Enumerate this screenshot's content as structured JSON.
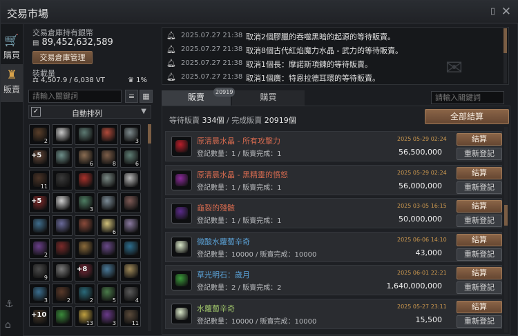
{
  "window": {
    "title": "交易市場",
    "phone_icon": "phone-icon",
    "close_icon": "close-icon"
  },
  "nav": {
    "items": [
      {
        "label": "購買",
        "icon": "cart-icon"
      },
      {
        "label": "販賣",
        "icon": "money-bag-icon"
      }
    ],
    "bottom_icons": [
      "anchor-icon",
      "camp-icon"
    ]
  },
  "warehouse": {
    "label": "交易倉庫持有銀幣",
    "amount": "89,452,632,589",
    "manage_label": "交易倉庫管理",
    "load_label": "裝載量",
    "load_value": "4,507.9 / 6,038 VT",
    "load_pct": "1%"
  },
  "inventory": {
    "search_placeholder": "請輸入關鍵詞",
    "sort_label": "自動排列",
    "sort_checked": "✓",
    "slots": [
      {
        "color": "#5a3f2a",
        "count": "2"
      },
      {
        "color": "#c8c8c8",
        "count": ""
      },
      {
        "color": "#5d7a73",
        "count": ""
      },
      {
        "color": "#b04a3a",
        "count": ""
      },
      {
        "color": "#7e8a8d",
        "count": "3"
      },
      {
        "color": "#6b4b3b",
        "count": "",
        "plus": "+5"
      },
      {
        "color": "#6e8f8a",
        "count": ""
      },
      {
        "color": "#8b6d52",
        "count": "6"
      },
      {
        "color": "#7d5e49",
        "count": "8"
      },
      {
        "color": "#5f7d74",
        "count": "6"
      },
      {
        "color": "#4a3326",
        "count": "11"
      },
      {
        "color": "#3a3a3a",
        "count": ""
      },
      {
        "color": "#a8312b",
        "count": ""
      },
      {
        "color": "#7b8a86",
        "count": ""
      },
      {
        "color": "#b9b9b9",
        "count": ""
      },
      {
        "color": "#8c2d2d",
        "count": "",
        "plus": "+5"
      },
      {
        "color": "#cfcfcf",
        "count": ""
      },
      {
        "color": "#4e7d63",
        "count": "3"
      },
      {
        "color": "#7b8b96",
        "count": ""
      },
      {
        "color": "#7d5a56",
        "count": ""
      },
      {
        "color": "#3f6d8c",
        "count": ""
      },
      {
        "color": "#6a6a9a",
        "count": ""
      },
      {
        "color": "#8a4a3a",
        "count": ""
      },
      {
        "color": "#d0c07a",
        "count": "6"
      },
      {
        "color": "#8a7aa0",
        "count": ""
      },
      {
        "color": "#6a3f8a",
        "count": "2"
      },
      {
        "color": "#7a2a2a",
        "count": ""
      },
      {
        "color": "#8a6a3a",
        "count": ""
      },
      {
        "color": "#6a4a8a",
        "count": ""
      },
      {
        "color": "#2d6d8d",
        "count": ""
      },
      {
        "color": "#4a4a4a",
        "count": "9"
      },
      {
        "color": "#7a7a7a",
        "count": ""
      },
      {
        "color": "#7a2a3a",
        "count": "",
        "plus": "+8"
      },
      {
        "color": "#4a7a9a",
        "count": ""
      },
      {
        "color": "#a08a5a",
        "count": ""
      },
      {
        "color": "#3a6d8d",
        "count": "3"
      },
      {
        "color": "#5a3a2a",
        "count": "2"
      },
      {
        "color": "#2a6a7a",
        "count": "2"
      },
      {
        "color": "#4a7a4a",
        "count": "5"
      },
      {
        "color": "#5a5a5a",
        "count": "4"
      },
      {
        "color": "#4a3a2a",
        "count": "",
        "plus": "+10"
      },
      {
        "color": "#3a8a3a",
        "count": ""
      },
      {
        "color": "#c0a040",
        "count": "13"
      },
      {
        "color": "#6a3a8a",
        "count": "3"
      },
      {
        "color": "#5a4a3a",
        "count": "11"
      }
    ]
  },
  "notices": [
    {
      "timestamp": "2025.07.27 21:38",
      "message": "取消2個膠臘的吞噬黑暗的起源的等待販賣。"
    },
    {
      "timestamp": "2025.07.27 21:38",
      "message": "取消8個古代紅焰魔力水晶 - 武力的等待販賣。"
    },
    {
      "timestamp": "2025.07.27 21:38",
      "message": "取消1個長：摩諾斯項鍊的等待販賣。"
    },
    {
      "timestamp": "2025.07.27 21:38",
      "message": "取消1個廣：特恩拉德耳環的等待販賣。"
    }
  ],
  "tabs": {
    "sell_label": "販賣",
    "buy_label": "購買",
    "sell_badge": "20919",
    "search_placeholder": "請輸入關鍵詞"
  },
  "summary": {
    "pending_label": "等待販賣",
    "pending_value": "334個",
    "separator": "/",
    "done_label": "完成販賣",
    "done_value": "20919個",
    "settle_all_label": "全部結算"
  },
  "listings": [
    {
      "name": "原清晨水晶 - 所有攻擊力",
      "name_color": "#d46a4f",
      "icon_color": "#b81e2a",
      "detail": "登記數量：1 / 販賣完成：1",
      "date": "2025 05-29 02:24",
      "price": "56,500,000",
      "settle": "結算",
      "relist": "重新登記"
    },
    {
      "name": "原清晨水晶 - 黑精靈的憤怒",
      "name_color": "#d46a4f",
      "icon_color": "#8a2a9a",
      "detail": "登記數量：1 / 販賣完成：1",
      "date": "2025 05-29 02:24",
      "price": "56,000,000",
      "settle": "結算",
      "relist": "重新登記"
    },
    {
      "name": "龜裂的殘骸",
      "name_color": "#d46a4f",
      "icon_color": "#5a2a8a",
      "detail": "登記數量：1 / 販賣完成：1",
      "date": "2025 03-05 16:15",
      "price": "50,000,000",
      "settle": "結算",
      "relist": "重新登記"
    },
    {
      "name": "微酸水蘿蔔辛奇",
      "name_color": "#5aa0d4",
      "icon_color": "#d8e6c8",
      "detail": "登記數量：10000 / 販賣完成：10000",
      "date": "2025 06-06 14:10",
      "price": "43,000",
      "settle": "結算",
      "relist": "重新登記"
    },
    {
      "name": "草光明石：歲月",
      "name_color": "#5aa0d4",
      "icon_color": "#3a9a3a",
      "detail": "登記數量：2 / 販賣完成：2",
      "date": "2025 06-01 22:21",
      "price": "1,640,000,000",
      "settle": "結算",
      "relist": "重新登記"
    },
    {
      "name": "水蘿蔔辛奇",
      "name_color": "#9fc46a",
      "icon_color": "#d8e6c8",
      "detail": "登記數量：10000 / 販賣完成：10000",
      "date": "2025 05-27 23:11",
      "price": "15,500",
      "settle": "結算",
      "relist": "重新登記"
    }
  ]
}
